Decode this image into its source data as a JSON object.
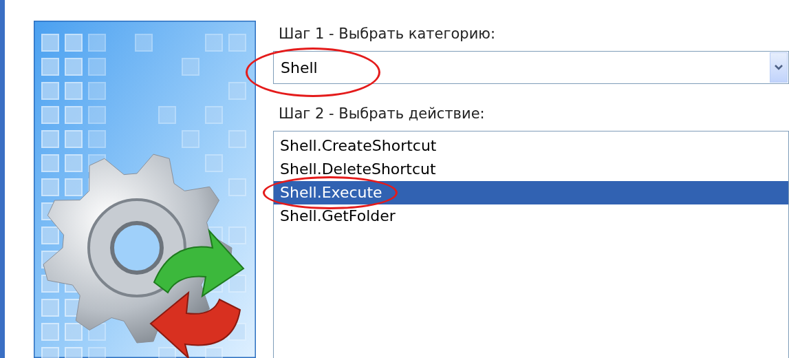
{
  "step1": {
    "label": "Шаг 1 - Выбрать категорию:"
  },
  "category": {
    "value": "Shell",
    "circled": true
  },
  "step2": {
    "label": "Шаг 2 - Выбрать действие:"
  },
  "actions": [
    {
      "label": "Shell.CreateShortcut",
      "selected": false,
      "circled": false
    },
    {
      "label": "Shell.DeleteShortcut",
      "selected": false,
      "circled": false
    },
    {
      "label": "Shell.Execute",
      "selected": true,
      "circled": true
    },
    {
      "label": "Shell.GetFolder",
      "selected": false,
      "circled": false
    }
  ]
}
